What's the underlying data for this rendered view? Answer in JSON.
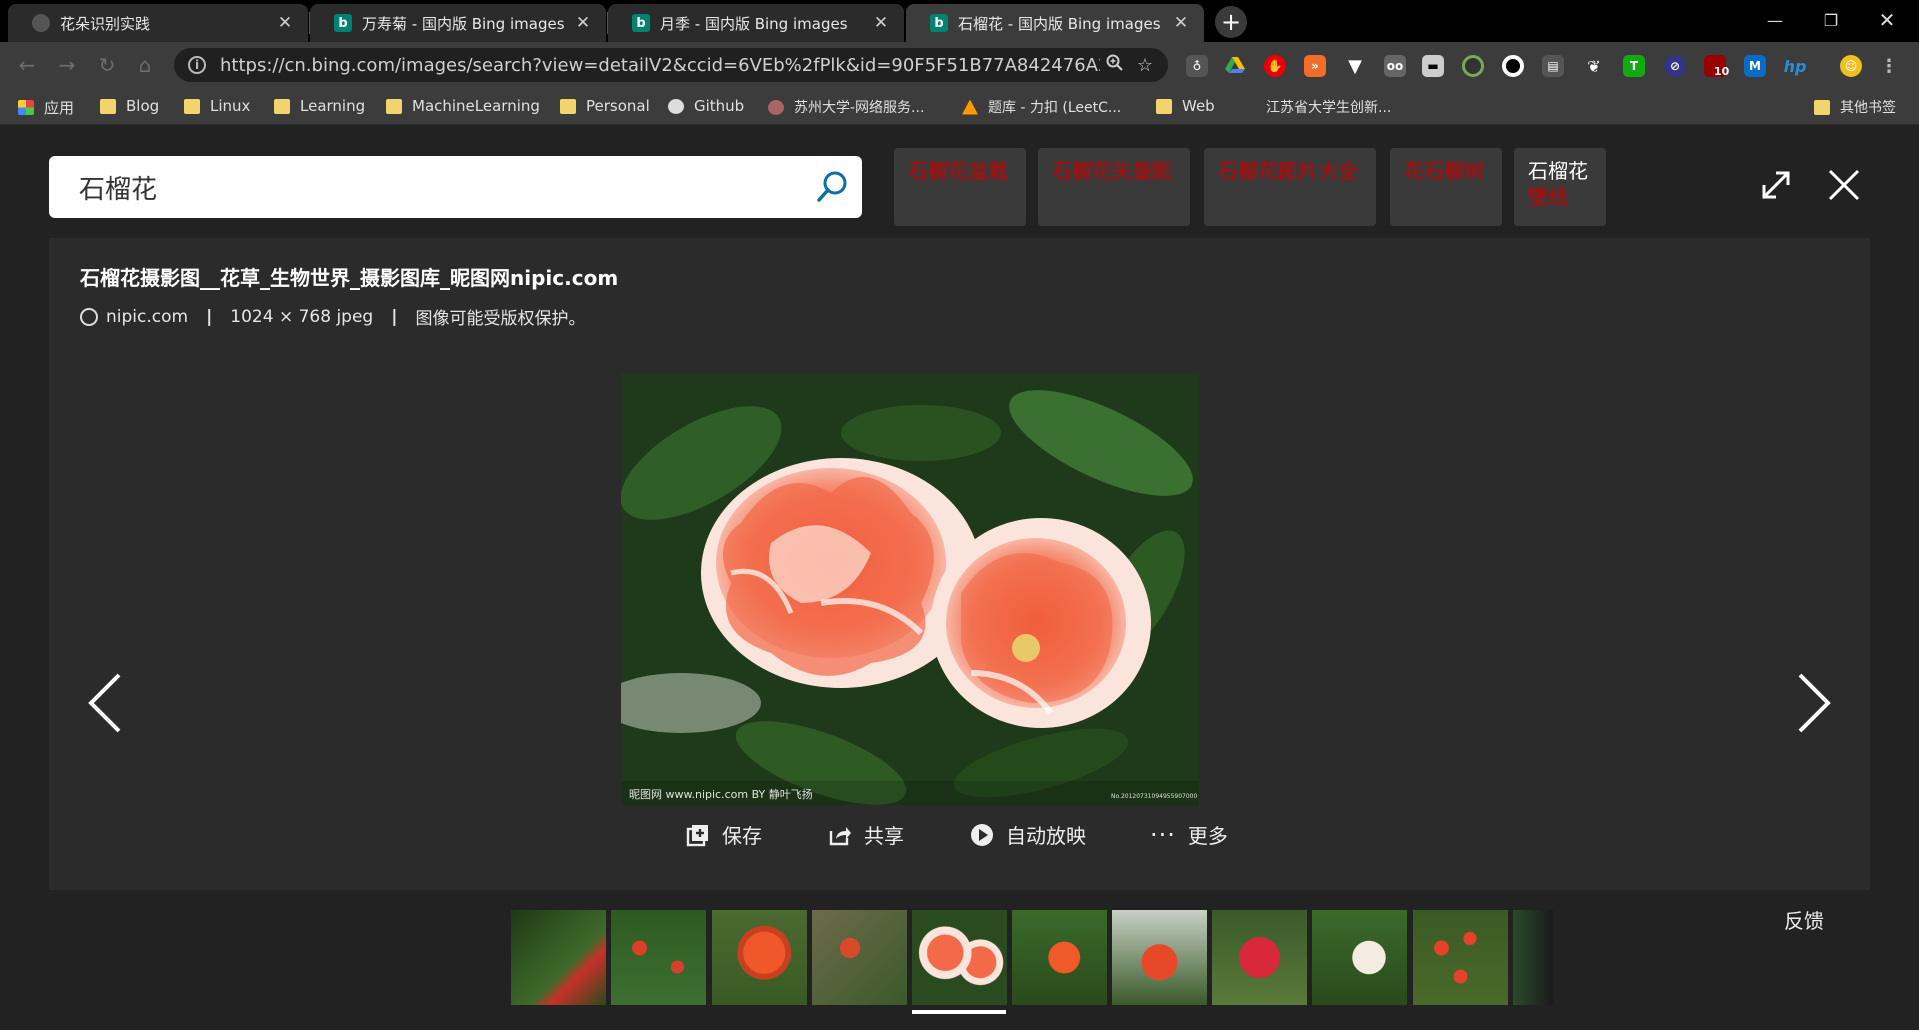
{
  "tabs": [
    {
      "title": "花朵识别实践",
      "icon": "globe-icon",
      "active": false
    },
    {
      "title": "万寿菊 - 国内版 Bing images",
      "icon": "bing-icon",
      "active": false
    },
    {
      "title": "月季 - 国内版 Bing images",
      "icon": "bing-icon",
      "active": false
    },
    {
      "title": "石榴花 - 国内版 Bing images",
      "icon": "bing-icon",
      "active": true
    }
  ],
  "toolbar": {
    "url": "https://cn.bing.com/images/search?view=detailV2&ccid=6VEb%2fPlk&id=90F5F51B77A842476A25F..."
  },
  "extensions": {
    "badge_count": "10"
  },
  "bookmarks": [
    {
      "label": "应用",
      "icon": "apps-icon"
    },
    {
      "label": "Blog",
      "icon": "folder-icon"
    },
    {
      "label": "Linux",
      "icon": "folder-icon"
    },
    {
      "label": "Learning",
      "icon": "folder-icon"
    },
    {
      "label": "MachineLearning",
      "icon": "folder-icon"
    },
    {
      "label": "Personal",
      "icon": "folder-icon"
    },
    {
      "label": "Github",
      "icon": "github-icon"
    },
    {
      "label": "苏州大学-网络服务...",
      "icon": "site-icon"
    },
    {
      "label": "题库 - 力扣 (LeetC...",
      "icon": "leetcode-icon"
    },
    {
      "label": "Web",
      "icon": "folder-icon"
    },
    {
      "label": "江苏省大学生创新...",
      "icon": "site-icon"
    },
    {
      "label": "其他书签",
      "icon": "folder-icon"
    }
  ],
  "search": {
    "query": "石榴花"
  },
  "related_searches": [
    {
      "line1": "石榴花盆栽",
      "line2": ""
    },
    {
      "line1": "石榴花矢量图",
      "line2": ""
    },
    {
      "line1": "石榴花图片大全",
      "line2": ""
    },
    {
      "line1": "花石榴树",
      "line2": ""
    },
    {
      "line1": "石榴花",
      "line2": "壁纸"
    }
  ],
  "detail": {
    "title": "石榴花摄影图__花草_生物世界_摄影图库_昵图网nipic.com",
    "source": "nipic.com",
    "dims": "1024 × 768 jpeg",
    "copyright": "图像可能受版权保护。",
    "watermark_left": "昵图网 www.nipic.com  BY 静叶飞扬",
    "watermark_right": "No.20120731094955907000"
  },
  "actions": {
    "save": "保存",
    "share": "共享",
    "slideshow": "自动放映",
    "more": "更多"
  },
  "feedback": "反馈",
  "colors": {
    "related_text": "#c80000",
    "page_bg": "#222222",
    "panel_bg": "#2b2b2b"
  }
}
